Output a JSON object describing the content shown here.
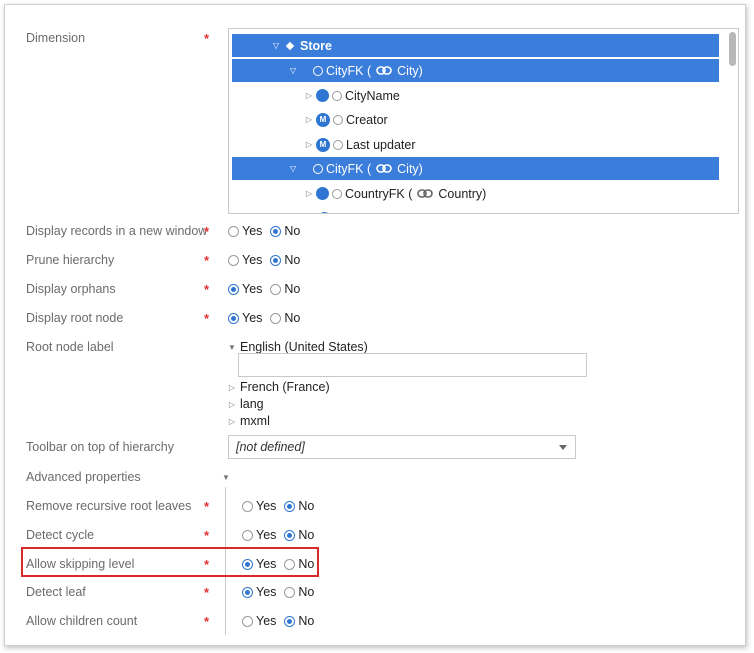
{
  "fields": {
    "dimension": {
      "label": "Dimension",
      "required": "*"
    },
    "display_new_window": {
      "label": "Display records in a new window",
      "required": "*",
      "yes": "Yes",
      "no": "No",
      "selected": "no"
    },
    "prune_hierarchy": {
      "label": "Prune hierarchy",
      "required": "*",
      "yes": "Yes",
      "no": "No",
      "selected": "no"
    },
    "display_orphans": {
      "label": "Display orphans",
      "required": "*",
      "yes": "Yes",
      "no": "No",
      "selected": "yes"
    },
    "display_root_node": {
      "label": "Display root node",
      "required": "*",
      "yes": "Yes",
      "no": "No",
      "selected": "yes"
    },
    "root_node_label": {
      "label": "Root node label"
    },
    "toolbar": {
      "label": "Toolbar on top of hierarchy",
      "value": "[not defined]"
    },
    "advanced": {
      "label": "Advanced properties"
    },
    "remove_recursive": {
      "label": "Remove recursive root leaves",
      "required": "*",
      "yes": "Yes",
      "no": "No",
      "selected": "no"
    },
    "detect_cycle": {
      "label": "Detect cycle",
      "required": "*",
      "yes": "Yes",
      "no": "No",
      "selected": "no"
    },
    "allow_skipping": {
      "label": "Allow skipping level",
      "required": "*",
      "yes": "Yes",
      "no": "No",
      "selected": "yes"
    },
    "detect_leaf": {
      "label": "Detect leaf",
      "required": "*",
      "yes": "Yes",
      "no": "No",
      "selected": "yes"
    },
    "allow_children_count": {
      "label": "Allow children count",
      "required": "*",
      "yes": "Yes",
      "no": "No",
      "selected": "no"
    }
  },
  "tree": {
    "store": "Store",
    "cityfk_1": "CityFK (",
    "city_1": "City)",
    "cityname": "CityName",
    "creator": "Creator",
    "last_updater": "Last updater",
    "cityfk_2": "CityFK (",
    "city_2": "City)",
    "countryfk": "CountryFK (",
    "country": "Country)",
    "m_badge": "M"
  },
  "languages": {
    "english": "English (United States)",
    "french": "French (France)",
    "lang": "lang",
    "mxml": "mxml"
  },
  "colors": {
    "selection": "#3a7ddb",
    "required": "#e0322f",
    "highlight": "#d92a2a"
  }
}
